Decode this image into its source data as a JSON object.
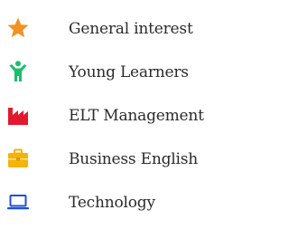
{
  "categories": [
    {
      "label": "General interest",
      "icon": "star-icon",
      "color": "#f39224"
    },
    {
      "label": "Young Learners",
      "icon": "child-icon",
      "color": "#1bbf6b"
    },
    {
      "label": "ELT Management",
      "icon": "factory-icon",
      "color": "#e3182f"
    },
    {
      "label": "Business English",
      "icon": "briefcase-icon",
      "color": "#f5b30a"
    },
    {
      "label": "Technology",
      "icon": "laptop-icon",
      "color": "#1a4fd8"
    }
  ]
}
